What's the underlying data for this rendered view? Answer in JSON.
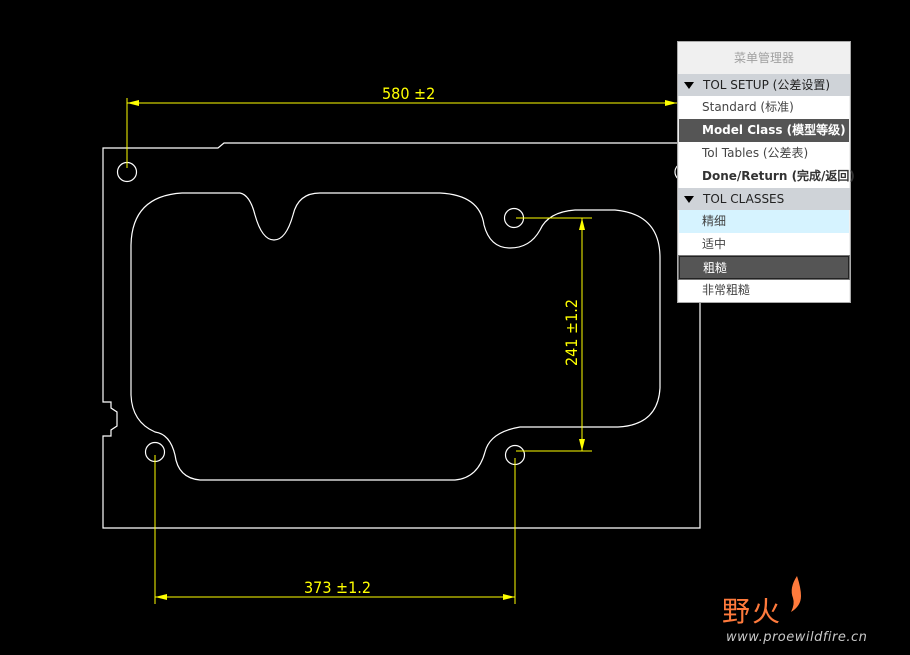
{
  "drawing": {
    "dim_top": "580 ±2",
    "dim_side": "241 ±1.2",
    "dim_bottom": "373 ±1.2",
    "line_color": "#ffffff",
    "dim_color": "#ffff00"
  },
  "menu": {
    "title": "菜单管理器",
    "tol_setup": {
      "header": "TOL SETUP (公差设置)",
      "items": [
        "Standard (标准)",
        "Model Class (模型等级)",
        "Tol Tables (公差表)",
        "Done/Return (完成/返回)"
      ]
    },
    "tol_classes": {
      "header": "TOL CLASSES",
      "items": [
        "精细",
        "适中",
        "粗糙",
        "非常粗糙"
      ]
    }
  },
  "watermark": {
    "logo": "野火",
    "url": "www.proewildfire.cn",
    "color": "#ff7a3c"
  }
}
